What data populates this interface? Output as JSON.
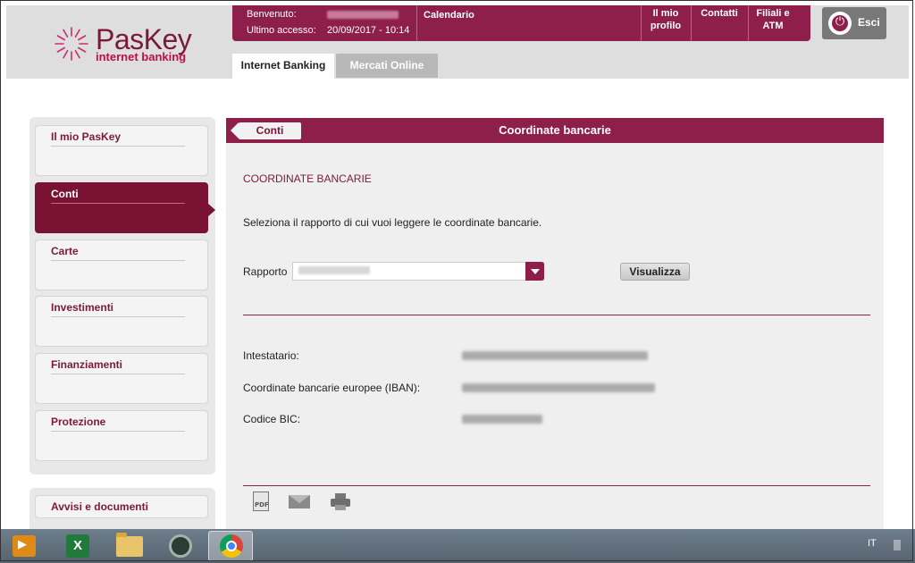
{
  "header": {
    "logo": {
      "name": "PasKey",
      "subtitle": "internet banking"
    },
    "welcome_label": "Benvenuto:",
    "last_access_label": "Ultimo accesso:",
    "last_access_value": "20/09/2017 - 10:14",
    "links": [
      {
        "label": "Calendario"
      },
      {
        "label": "Il mio profilo"
      },
      {
        "label": "Contatti"
      },
      {
        "label": "Filiali e ATM"
      }
    ],
    "logout_label": "Esci",
    "tabs": [
      {
        "label": "Internet Banking",
        "active": true
      },
      {
        "label": "Mercati Online",
        "active": false
      }
    ]
  },
  "sidebar": {
    "items": [
      {
        "label": "Il mio PasKey",
        "active": false
      },
      {
        "label": "Conti",
        "active": true
      },
      {
        "label": "Carte",
        "active": false
      },
      {
        "label": "Investimenti",
        "active": false
      },
      {
        "label": "Finanziamenti",
        "active": false
      },
      {
        "label": "Protezione",
        "active": false
      }
    ],
    "secondary": {
      "label": "Avvisi e documenti"
    }
  },
  "main": {
    "back_label": "Conti",
    "title": "Coordinate bancarie",
    "section_title": "COORDINATE BANCARIE",
    "instruction": "Seleziona il rapporto di cui vuoi leggere le coordinate bancarie.",
    "rapporto_label": "Rapporto",
    "view_button": "Visualizza",
    "fields": [
      {
        "label": "Intestatario:"
      },
      {
        "label": "Coordinate bancarie europee (IBAN):"
      },
      {
        "label": "Codice BIC:"
      }
    ],
    "actions": [
      {
        "icon": "pdf-icon"
      },
      {
        "icon": "mail-icon"
      },
      {
        "icon": "printer-icon"
      }
    ],
    "pdf_icon_text": "PDF"
  },
  "taskbar": {
    "language": "IT",
    "apps": [
      "media-player-icon",
      "excel-icon",
      "file-explorer-icon",
      "app-circle-icon",
      "chrome-icon"
    ],
    "excel_glyph": "X"
  },
  "colors": {
    "brand": "#8e1f4a",
    "brand_dark": "#7a1233",
    "panel_bg": "#efefef"
  }
}
